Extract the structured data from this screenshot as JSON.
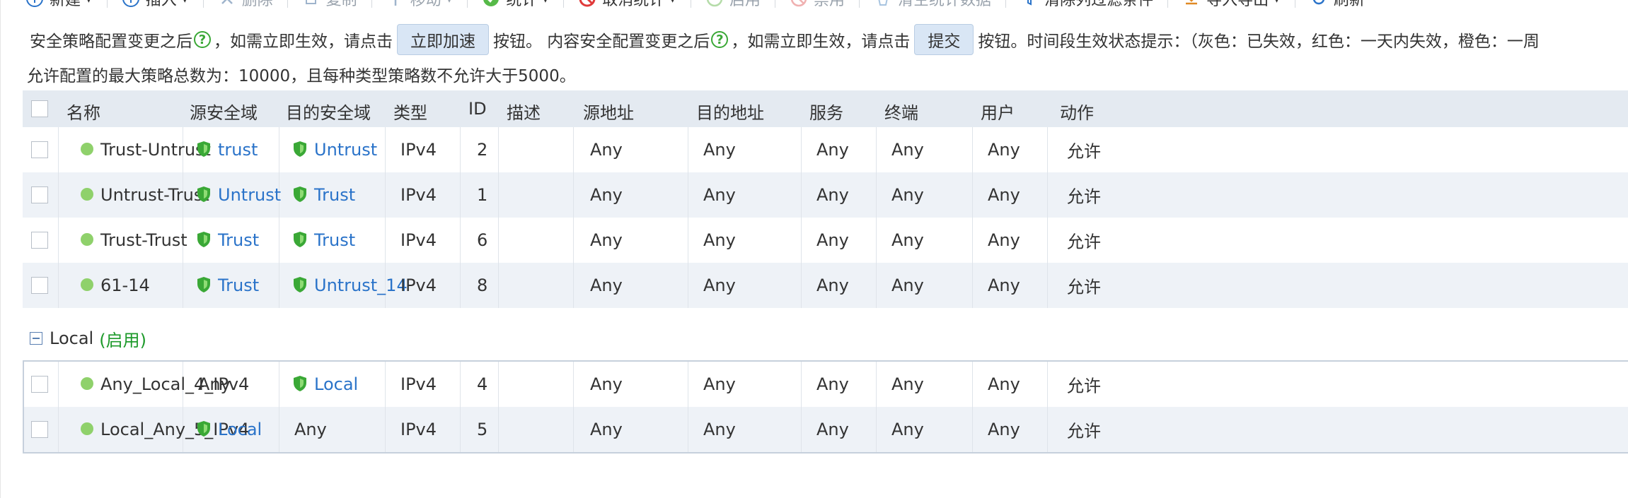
{
  "toolbar": {
    "items": [
      {
        "label": "新建",
        "icon": "plus-circle-icon",
        "caret": true,
        "disabled": false
      },
      {
        "label": "插入",
        "icon": "plus-circle-icon",
        "caret": true,
        "disabled": false
      },
      {
        "label": "删除",
        "icon": "close-icon",
        "caret": false,
        "disabled": true
      },
      {
        "label": "复制",
        "icon": "copy-icon",
        "caret": false,
        "disabled": true
      },
      {
        "label": "移动",
        "icon": "move-icon",
        "caret": true,
        "disabled": true
      },
      {
        "label": "统计",
        "icon": "stats-icon",
        "caret": true,
        "disabled": false
      },
      {
        "label": "取消统计",
        "icon": "cancel-icon",
        "caret": true,
        "disabled": false
      },
      {
        "label": "启用",
        "icon": "enable-icon",
        "caret": false,
        "disabled": true
      },
      {
        "label": "禁用",
        "icon": "disable-icon",
        "caret": false,
        "disabled": true
      },
      {
        "label": "清空统计数据",
        "icon": "clear-icon",
        "caret": false,
        "disabled": true
      },
      {
        "label": "清除列过滤条件",
        "icon": "filter-clear-icon",
        "caret": false,
        "disabled": false
      },
      {
        "label": "导入导出",
        "icon": "import-export-icon",
        "caret": true,
        "disabled": false
      },
      {
        "label": "刷新",
        "icon": "refresh-icon",
        "caret": false,
        "disabled": false
      }
    ]
  },
  "info": {
    "line1_a": "安全策略配置变更之后",
    "line1_b": "，如需立即生效，请点击",
    "accelerate_button": "立即加速",
    "line1_c": "按钮。 内容安全配置变更之后",
    "line1_d": "，如需立即生效，请点击",
    "submit_button": "提交",
    "line1_e": "按钮。时间段生效状态提示：（灰色：已失效，红色：一天内失效，橙色：一周",
    "help_glyph": "?",
    "line2": "允许配置的最大策略总数为：10000，且每种类型策略数不允许大于5000。"
  },
  "table": {
    "columns": [
      "名称",
      "源安全域",
      "目的安全域",
      "类型",
      "ID",
      "描述",
      "源地址",
      "目的地址",
      "服务",
      "终端",
      "用户",
      "动作"
    ],
    "rows": [
      {
        "name": "Trust-Untrust",
        "src_zone": "trust",
        "dst_zone": "Untrust",
        "type": "IPv4",
        "id": "2",
        "desc": "",
        "src_addr": "Any",
        "dst_addr": "Any",
        "service": "Any",
        "terminal": "Any",
        "user": "Any",
        "action": "允许"
      },
      {
        "name": "Untrust-Trust",
        "src_zone": "Untrust",
        "dst_zone": "Trust",
        "type": "IPv4",
        "id": "1",
        "desc": "",
        "src_addr": "Any",
        "dst_addr": "Any",
        "service": "Any",
        "terminal": "Any",
        "user": "Any",
        "action": "允许"
      },
      {
        "name": "Trust-Trust",
        "src_zone": "Trust",
        "dst_zone": "Trust",
        "type": "IPv4",
        "id": "6",
        "desc": "",
        "src_addr": "Any",
        "dst_addr": "Any",
        "service": "Any",
        "terminal": "Any",
        "user": "Any",
        "action": "允许"
      },
      {
        "name": "61-14",
        "src_zone": "Trust",
        "dst_zone": "Untrust_14",
        "type": "IPv4",
        "id": "8",
        "desc": "",
        "src_addr": "Any",
        "dst_addr": "Any",
        "service": "Any",
        "terminal": "Any",
        "user": "Any",
        "action": "允许"
      }
    ],
    "group": {
      "name": "Local",
      "status": "(启用)"
    },
    "group_rows": [
      {
        "name": "Any_Local_4_IPv4",
        "src_zone": "Any",
        "src_is_zone": false,
        "dst_zone": "Local",
        "dst_is_zone": true,
        "type": "IPv4",
        "id": "4",
        "desc": "",
        "src_addr": "Any",
        "dst_addr": "Any",
        "service": "Any",
        "terminal": "Any",
        "user": "Any",
        "action": "允许"
      },
      {
        "name": "Local_Any_5_IPv4",
        "src_zone": "Local",
        "src_is_zone": true,
        "dst_zone": "Any",
        "dst_is_zone": false,
        "type": "IPv4",
        "id": "5",
        "desc": "",
        "src_addr": "Any",
        "dst_addr": "Any",
        "service": "Any",
        "terminal": "Any",
        "user": "Any",
        "action": "允许"
      }
    ]
  },
  "colors": {
    "zone_link": "#2a73c9",
    "action_allow": "#1e9a2b",
    "status_dot": "#8fd16b",
    "shield": "#3aa836",
    "header_bg": "#e4eaf1",
    "row_alt_bg": "#eef2f7"
  }
}
